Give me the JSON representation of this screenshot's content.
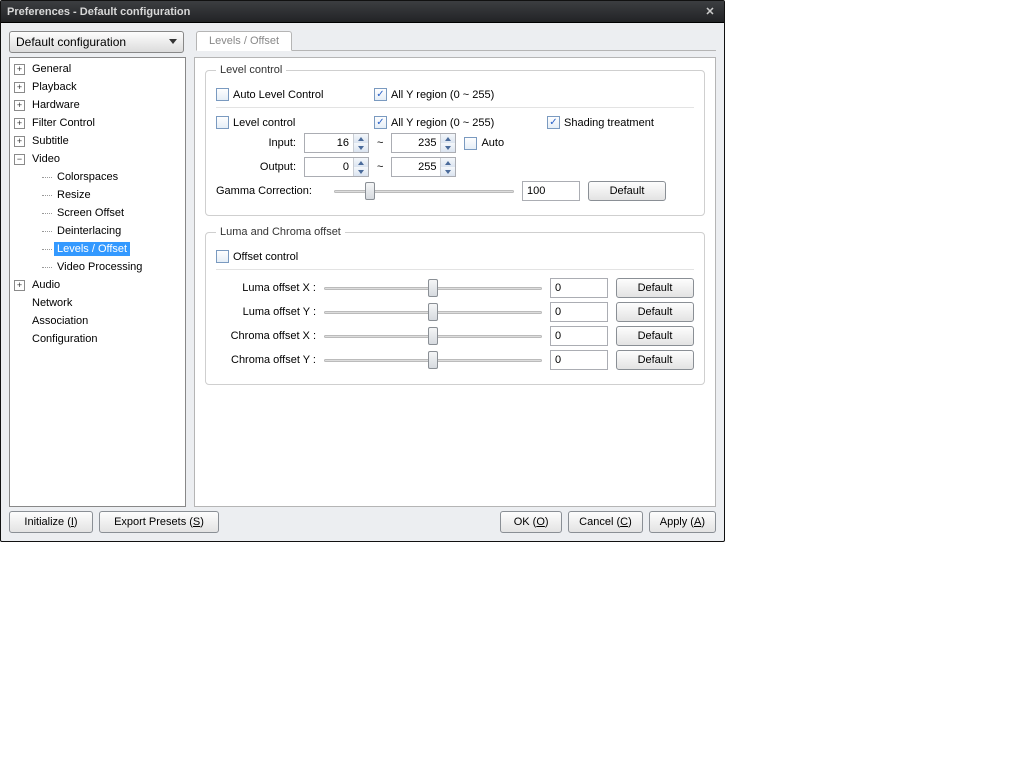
{
  "title": "Preferences - Default configuration",
  "preset": "Default configuration",
  "tab_label": "Levels / Offset",
  "tree": {
    "general": "General",
    "playback": "Playback",
    "hardware": "Hardware",
    "filter_control": "Filter Control",
    "subtitle": "Subtitle",
    "video": "Video",
    "colorspaces": "Colorspaces",
    "resize": "Resize",
    "screen_offset": "Screen Offset",
    "deinterlacing": "Deinterlacing",
    "levels_offset": "Levels / Offset",
    "video_processing": "Video Processing",
    "audio": "Audio",
    "network": "Network",
    "association": "Association",
    "configuration": "Configuration"
  },
  "level_control": {
    "legend": "Level control",
    "auto_level": "Auto Level Control",
    "all_y_region": "All Y region (0 ~ 255)",
    "level_control_chk": "Level control",
    "shading": "Shading treatment",
    "input_label": "Input:",
    "output_label": "Output:",
    "input_low": "16",
    "input_high": "235",
    "output_low": "0",
    "output_high": "255",
    "auto_chk": "Auto",
    "tilde": "~",
    "gamma_label": "Gamma Correction:",
    "gamma_value": "100",
    "default_btn": "Default"
  },
  "luma": {
    "legend": "Luma and Chroma offset",
    "offset_control": "Offset control",
    "lx_label": "Luma offset X :",
    "ly_label": "Luma offset Y :",
    "cx_label": "Chroma offset X :",
    "cy_label": "Chroma offset Y :",
    "lx_val": "0",
    "ly_val": "0",
    "cx_val": "0",
    "cy_val": "0",
    "default_btn": "Default"
  },
  "buttons": {
    "initialize": "Initialize (",
    "initialize_u": "I",
    "initialize2": ")",
    "export": "Export Presets (",
    "export_u": "S",
    "export2": ")",
    "ok": "OK (",
    "ok_u": "O",
    "ok2": ")",
    "cancel": "Cancel (",
    "cancel_u": "C",
    "cancel2": ")",
    "apply": "Apply (",
    "apply_u": "A",
    "apply2": ")"
  }
}
